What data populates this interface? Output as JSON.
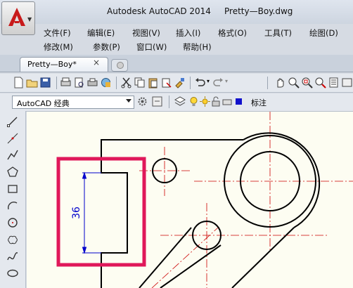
{
  "window": {
    "title": "Autodesk AutoCAD 2014     Pretty—Boy.dwg"
  },
  "menu": {
    "row1": [
      "文件(F)",
      "编辑(E)",
      "视图(V)",
      "插入(I)",
      "格式(O)",
      "工具(T)",
      "绘图(D)"
    ],
    "row2": [
      "修改(M)",
      "参数(P)",
      "窗口(W)",
      "帮助(H)"
    ]
  },
  "tabs": {
    "active": "Pretty—Boy*",
    "close_symbol": "×"
  },
  "workspace": {
    "selected": "AutoCAD 经典"
  },
  "layer": {
    "current": "标注"
  },
  "drawing": {
    "dimension_value": "36"
  },
  "colors": {
    "highlight": "#e0185a",
    "centerline": "#cc0000",
    "dimension": "#0000cc",
    "canvas": "#fdfdf2"
  }
}
